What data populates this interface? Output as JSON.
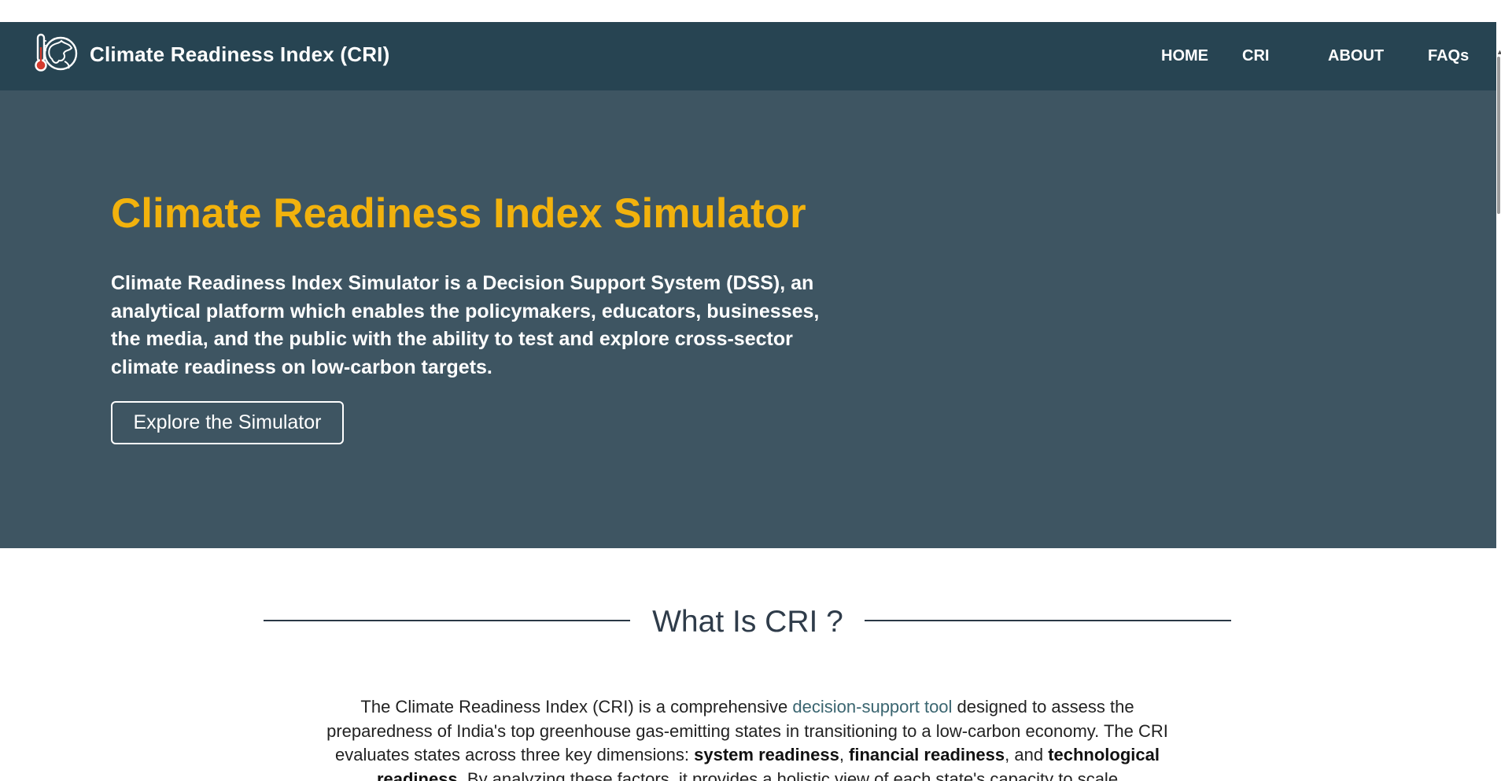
{
  "navbar": {
    "title": "Climate Readiness Index (CRI)",
    "logo_icon": "globe-thermometer-icon",
    "links": [
      {
        "label": "HOME"
      },
      {
        "label": "CRI"
      },
      {
        "label": "ABOUT"
      },
      {
        "label": "FAQs"
      }
    ]
  },
  "hero": {
    "title": "Climate Readiness Index Simulator",
    "description": "Climate Readiness Index Simulator is a Decision Support System (DSS), an analytical platform which enables the policymakers, educators, businesses, the media, and the public with the ability to test and explore cross-sector climate readiness on low-carbon targets.",
    "button_label": "Explore the Simulator"
  },
  "what_is": {
    "heading": "What Is CRI ?",
    "intro": {
      "part1": "The Climate Readiness Index (CRI) is a comprehensive ",
      "link": "decision-support tool",
      "part2": " designed to assess the preparedness of India's top greenhouse gas-emitting states in transitioning to a low-carbon economy. The CRI evaluates states across three key dimensions: ",
      "dim1": "system readiness",
      "sep1": ", ",
      "dim2": "financial readiness",
      "sep2": ", and ",
      "dim3": "technological readiness",
      "part3": ". By analyzing these factors, it provides a holistic view of each state's capacity to scale"
    }
  },
  "colors": {
    "navbar_bg": "#274452",
    "hero_bg": "#3e5562",
    "hero_title": "#f2b20d",
    "link": "#3a6570"
  }
}
